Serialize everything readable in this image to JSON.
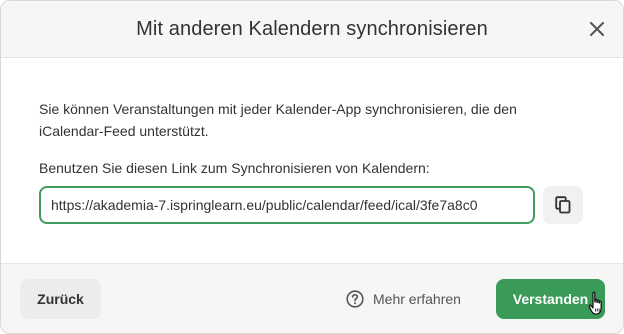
{
  "dialog": {
    "title": "Mit anderen Kalendern synchronisieren",
    "close_icon": "close-icon"
  },
  "body": {
    "description": "Sie können Veranstaltungen mit jeder Kalender-App synchronisieren, die den iCalendar-Feed unterstützt.",
    "link_label": "Benutzen Sie diesen Link zum Synchronisieren von Kalendern:",
    "link_value": "https://akademia-7.ispringlearn.eu/public/calendar/feed/ical/3fe7a8c0",
    "copy_icon": "copy-icon"
  },
  "footer": {
    "back_label": "Zurück",
    "help_label": "Mehr erfahren",
    "help_icon": "help-circle-icon",
    "confirm_label": "Verstanden"
  },
  "colors": {
    "accent": "#3a9a57",
    "input_border": "#3f9d5d",
    "header_bg": "#f6f6f6",
    "text": "#333333"
  }
}
